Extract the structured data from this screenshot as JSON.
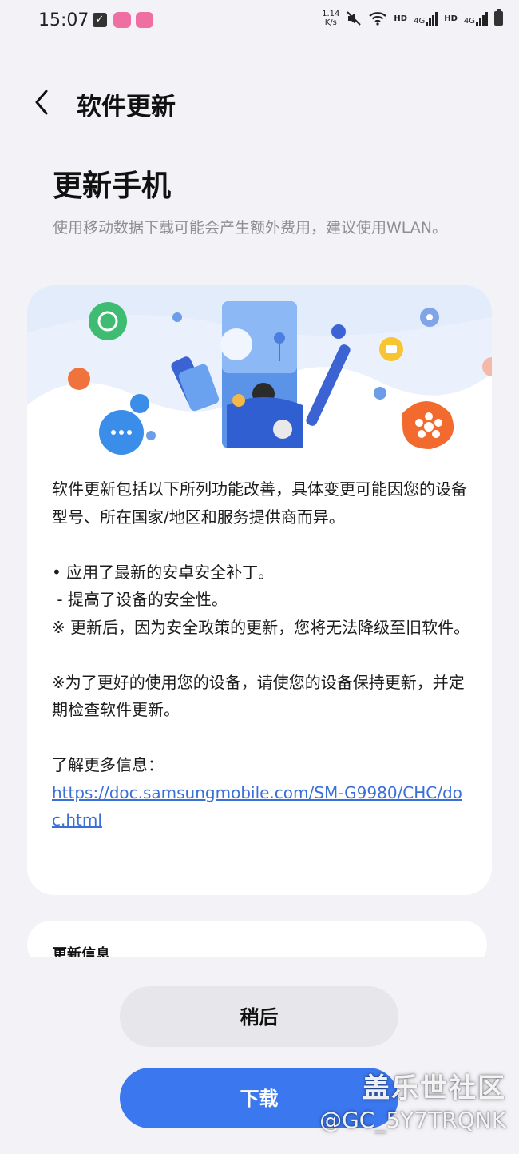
{
  "status_bar": {
    "time": "15:07",
    "net_speed_value": "1.14",
    "net_speed_unit": "K/s",
    "hd1": "HD",
    "net1": "4G",
    "hd2": "HD",
    "net2": "4G"
  },
  "header": {
    "back_icon": "chevron-left-icon",
    "title": "软件更新"
  },
  "main": {
    "title": "更新手机",
    "description": "使用移动数据下载可能会产生额外费用，建议使用WLAN。"
  },
  "card": {
    "intro": "软件更新包括以下所列功能改善，具体变更可能因您的设备型号、所在国家/地区和服务提供商而异。",
    "bullet1": "• 应用了最新的安卓安全补丁。",
    "bullet1_sub": " - 提高了设备的安全性。",
    "note1": "※ 更新后，因为安全政策的更新，您将无法降级至旧软件。",
    "note2": "※为了更好的使用您的设备，请使您的设备保持更新，并定期检查软件更新。",
    "more_info_label": "了解更多信息：",
    "more_info_link": "https://doc.samsungmobile.com/SM-G9980/CHC/doc.html"
  },
  "update_info": {
    "title": "更新信息"
  },
  "buttons": {
    "later": "稍后",
    "download": "下载"
  },
  "watermark": {
    "line1": "盖乐世社区",
    "line2": "@GC_5Y7TRQNK"
  },
  "colors": {
    "background": "#f2f2f7",
    "accent": "#3b78f0",
    "link": "#3a6fd8"
  }
}
